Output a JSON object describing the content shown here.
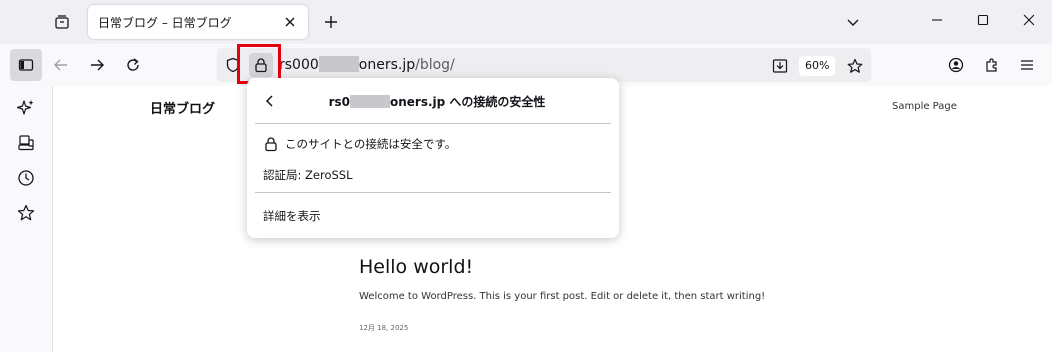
{
  "tabs": [
    {
      "title": "日常ブログ – 日常ブログ",
      "active": true
    }
  ],
  "icons": {
    "tab_list": "tab-list-icon",
    "close_tab": "close-icon",
    "new_tab": "plus-icon",
    "overflow": "chevron-down-icon",
    "minimize": "minimize-icon",
    "maximize": "maximize-icon",
    "close_window": "close-icon",
    "sidebar": "sidebar-icon",
    "back": "arrow-left-icon",
    "forward": "arrow-right-icon",
    "reload": "reload-icon",
    "tracking": "shield-icon",
    "site_info": "lock-icon",
    "download": "download-icon",
    "bookmark": "star-icon",
    "account": "account-icon",
    "extensions": "puzzle-icon",
    "menu": "hamburger-icon",
    "ai": "sparkle-icon",
    "synced": "synced-tabs-icon",
    "history": "clock-icon",
    "bookmarks": "star-icon"
  },
  "urlbar": {
    "prefix": "rs000",
    "host_suffix": "oners.jp",
    "path": "/blog/",
    "zoom": "60%"
  },
  "popup": {
    "header_prefix": "rs0",
    "header_suffix": "oners.jp への接続の安全性",
    "secure_text": "このサイトとの接続は安全です。",
    "issuer": "認証局: ZeroSSL",
    "more_info": "詳細を表示"
  },
  "page": {
    "site_title": "日常ブログ",
    "nav_item": "Sample Page",
    "post_title": "Hello world!",
    "post_body": "Welcome to WordPress. This is your first post. Edit or delete it, then start writing!",
    "post_date": "12月 18, 2025"
  },
  "colors": {
    "highlight": "#e2000f",
    "chrome_bg": "#f0f0f4",
    "toolbar_bg": "#f9f9fb"
  }
}
